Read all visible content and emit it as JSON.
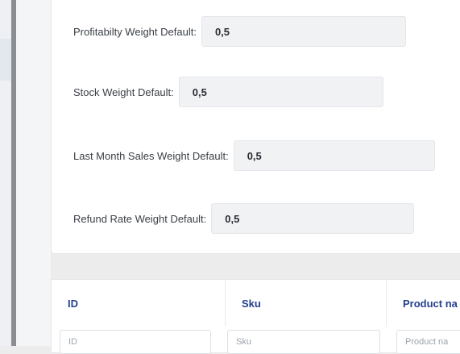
{
  "settings": {
    "fields": [
      {
        "label": "Profitabilty Weight Default:",
        "value": "0,5"
      },
      {
        "label": "Stock Weight Default:",
        "value": "0,5"
      },
      {
        "label": "Last Month Sales Weight Default:",
        "value": "0,5"
      },
      {
        "label": "Refund Rate Weight Default:",
        "value": "0,5"
      }
    ]
  },
  "table": {
    "columns": [
      {
        "header": "ID",
        "placeholder": "ID"
      },
      {
        "header": "Sku",
        "placeholder": "Sku"
      },
      {
        "header": "Product na",
        "placeholder": "Product na"
      }
    ]
  }
}
